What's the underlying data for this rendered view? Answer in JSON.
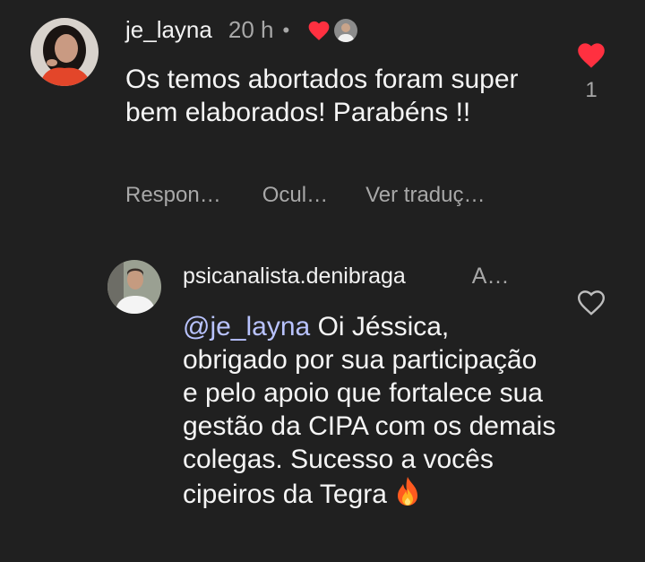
{
  "comment": {
    "username": "je_layna",
    "time": "20 h",
    "separator": "•",
    "text": "Os temos abortados foram super bem elaborados! Parabéns !!",
    "like_count": "1",
    "actions": {
      "reply": "Respon…",
      "hide": "Ocul…",
      "translate": "Ver traduç…"
    }
  },
  "reply": {
    "username": "psicanalista.denibraga",
    "time": "A…",
    "mention": "@je_layna",
    "text": "Oi Jéssica, obrigado por sua participação e pelo apoio que fortalece sua gestão da CIPA com os demais colegas. Sucesso a vocês cipeiros da Tegra",
    "emoji": "🔥"
  },
  "colors": {
    "background": "#202020",
    "like_red": "#ff3040",
    "muted": "#a8a8a8",
    "mention": "#b9c3ff"
  },
  "icons": {
    "comment_like": "heart-filled-icon",
    "author_liked": "heart-filled-icon",
    "reply_like": "heart-outline-icon",
    "fire": "fire-emoji"
  }
}
